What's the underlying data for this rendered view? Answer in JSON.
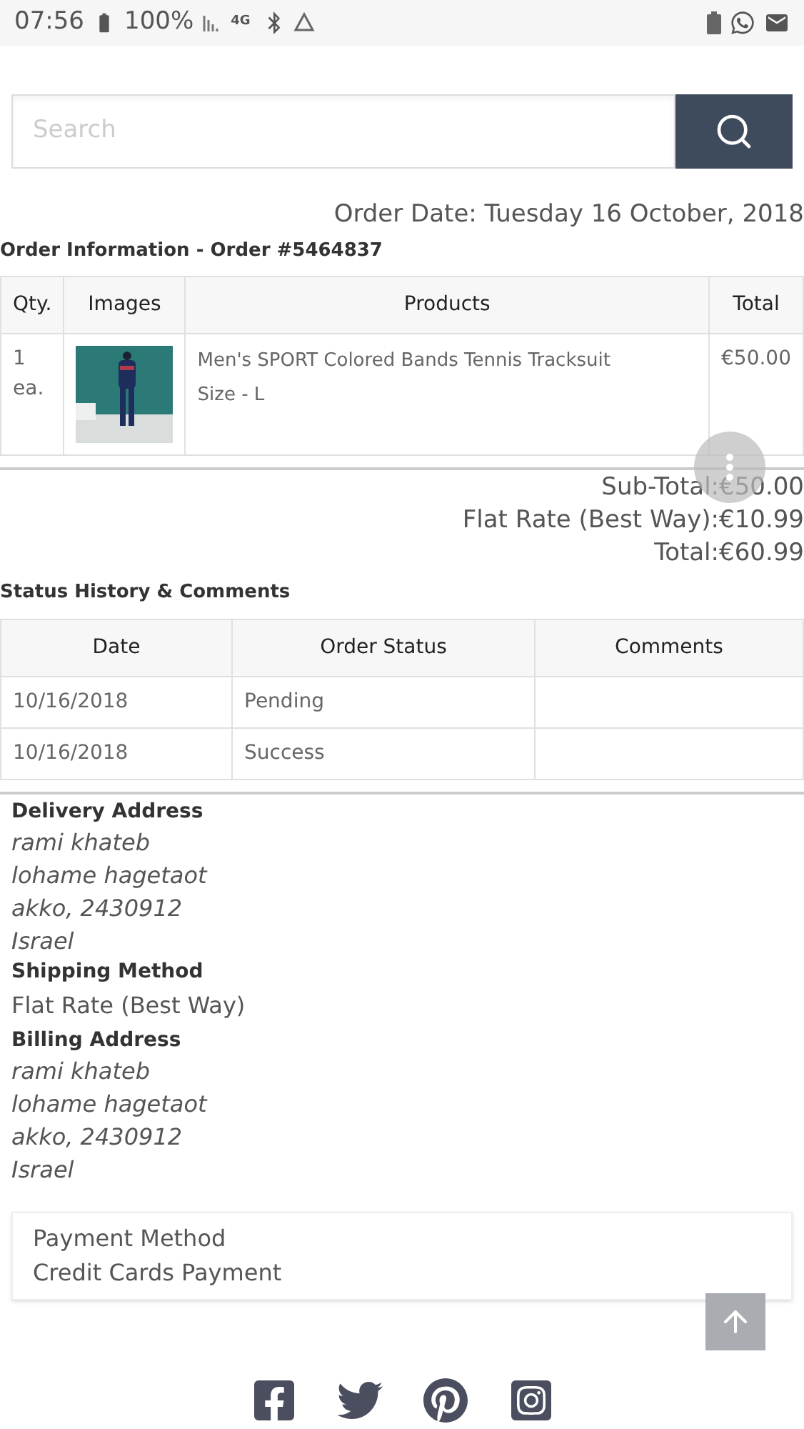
{
  "status_bar": {
    "time": "07:56",
    "battery": "100%",
    "network": "4G"
  },
  "search": {
    "placeholder": "Search"
  },
  "order_date": "Order Date: Tuesday 16 October, 2018",
  "order_title": "Order Information - Order #5464837",
  "order_table": {
    "columns": [
      "Qty.",
      "Images",
      "Products",
      "Total"
    ],
    "rows": [
      {
        "qty": "1 ea.",
        "product": "Men's SPORT Colored Bands Tennis Tracksuit",
        "option": "Size - L",
        "total": "€50.00"
      }
    ]
  },
  "totals": [
    "Sub-Total:€50.00",
    "Flat Rate (Best Way):€10.99",
    "Total:€60.99"
  ],
  "history_title": "Status History & Comments",
  "history_table": {
    "columns": [
      "Date",
      "Order Status",
      "Comments"
    ],
    "rows": [
      {
        "date": "10/16/2018",
        "status": "Pending"
      },
      {
        "date": "10/16/2018",
        "status": "Success"
      }
    ]
  },
  "sections": [
    {
      "kind": "address",
      "title": "Delivery Address",
      "lines": [
        "rami khateb",
        "lohame hagetaot",
        "akko, 2430912",
        "Israel"
      ]
    },
    {
      "kind": "plain",
      "title": "Shipping Method",
      "lines": [
        "Flat Rate (Best Way)"
      ]
    },
    {
      "kind": "address",
      "title": "Billing Address",
      "lines": [
        "rami khateb",
        "lohame hagetaot",
        "akko, 2430912",
        "Israel"
      ]
    }
  ],
  "payment": {
    "title": "Payment Method",
    "value": "Credit Cards Payment"
  }
}
